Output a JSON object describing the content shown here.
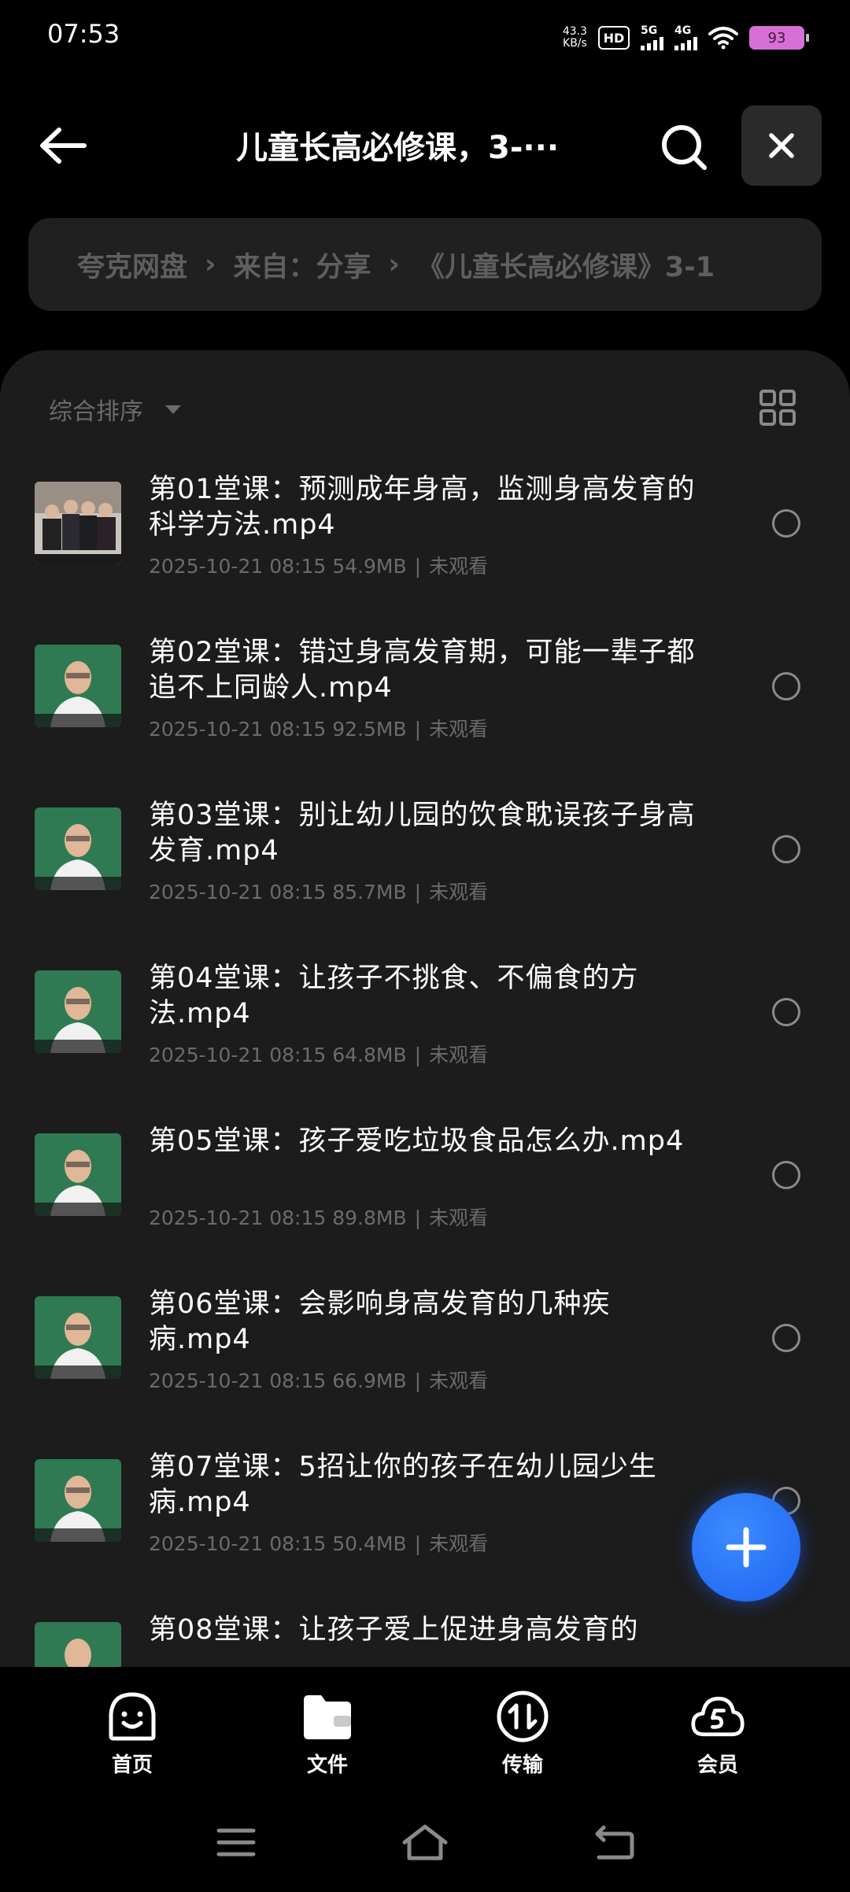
{
  "status_bar": {
    "time": "07:53",
    "net_speed_value": "43.3",
    "net_speed_unit": "KB/s",
    "hd_label": "HD",
    "sim1_label": "5G",
    "sim2_label": "4G",
    "battery": "93"
  },
  "header": {
    "title": "儿童长高必修课，3-···",
    "back_icon": "arrow-left-icon",
    "search_icon": "search-icon",
    "close_icon": "close-icon"
  },
  "breadcrumb": {
    "items": [
      "夸克网盘",
      "来自：分享",
      "《儿童长高必修课》3-1"
    ],
    "separator": "›"
  },
  "toolbar": {
    "sort_label": "综合排序",
    "grid_icon": "grid-view-icon"
  },
  "files": [
    {
      "name": "第01堂课：预测成年身高，监测身高发育的科学方法.mp4",
      "date": "2025-10-21 08:15",
      "size": "54.9MB",
      "status": "未观看"
    },
    {
      "name": "第02堂课：错过身高发育期，可能一辈子都追不上同龄人.mp4",
      "date": "2025-10-21 08:15",
      "size": "92.5MB",
      "status": "未观看"
    },
    {
      "name": "第03堂课：别让幼儿园的饮食耽误孩子身高发育.mp4",
      "date": "2025-10-21 08:15",
      "size": "85.7MB",
      "status": "未观看"
    },
    {
      "name": "第04堂课：让孩子不挑食、不偏食的方法.mp4",
      "date": "2025-10-21 08:15",
      "size": "64.8MB",
      "status": "未观看"
    },
    {
      "name": "第05堂课：孩子爱吃垃圾食品怎么办.mp4",
      "date": "2025-10-21 08:15",
      "size": "89.8MB",
      "status": "未观看"
    },
    {
      "name": "第06堂课：会影响身高发育的几种疾病.mp4",
      "date": "2025-10-21 08:15",
      "size": "66.9MB",
      "status": "未观看"
    },
    {
      "name": "第07堂课：5招让你的孩子在幼儿园少生病.mp4",
      "date": "2025-10-21 08:15",
      "size": "50.4MB",
      "status": "未观看"
    },
    {
      "name": "第08堂课：让孩子爱上促进身高发育的",
      "date": "",
      "size": "",
      "status": ""
    }
  ],
  "fab": {
    "icon": "plus-icon"
  },
  "bottom_nav": [
    {
      "label": "首页",
      "icon": "home-face-icon"
    },
    {
      "label": "文件",
      "icon": "folder-icon"
    },
    {
      "label": "传输",
      "icon": "transfer-icon"
    },
    {
      "label": "会员",
      "icon": "membership-cloud-icon"
    }
  ],
  "system_nav": [
    "menu-icon",
    "home-icon",
    "back-icon"
  ],
  "colors": {
    "background": "#000000",
    "panel": "#1c1c1c",
    "accent": "#1c63f0",
    "muted_text": "#6b6b6b"
  }
}
